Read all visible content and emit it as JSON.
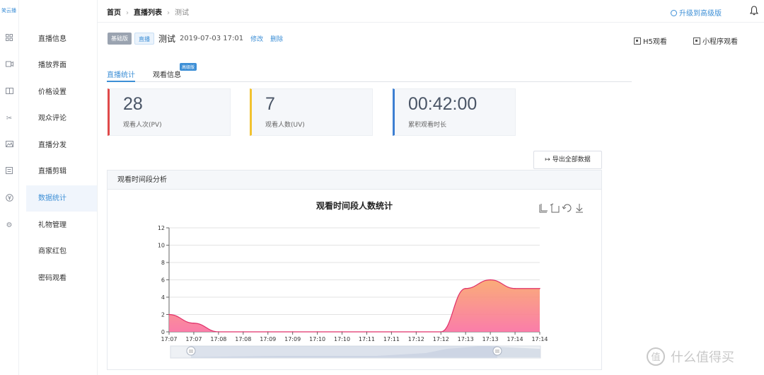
{
  "logo_text": "笑云播",
  "rail_icons": [
    "grid-icon",
    "video-icon",
    "book-icon",
    "scissors-icon",
    "image-icon",
    "list-icon",
    "yen-icon",
    "gear-icon"
  ],
  "sidebar": {
    "items": [
      {
        "label": "直播信息"
      },
      {
        "label": "播放界面"
      },
      {
        "label": "价格设置"
      },
      {
        "label": "观众评论"
      },
      {
        "label": "直播分发"
      },
      {
        "label": "直播剪辑"
      },
      {
        "label": "数据统计"
      },
      {
        "label": "礼物管理"
      },
      {
        "label": "商家红包"
      },
      {
        "label": "密码观看"
      }
    ],
    "active_index": 6
  },
  "breadcrumb": {
    "home": "首页",
    "list": "直播列表",
    "current": "测试"
  },
  "upgrade_label": "升级到高级版",
  "live": {
    "tag_plan": "基础版",
    "tag_type": "直播",
    "title": "测试",
    "time": "2019-07-03 17:01",
    "edit_label": "修改",
    "delete_label": "删除"
  },
  "watch_h5": "H5观看",
  "watch_mini": "小程序观看",
  "tabs": {
    "stats": "直播统计",
    "viewers": "观看信息",
    "viewers_badge": "高级版"
  },
  "stats": [
    {
      "value": "28",
      "label": "观看人次(PV)",
      "color": "#e04a4a"
    },
    {
      "value": "7",
      "label": "观看人数(UV)",
      "color": "#f2c230"
    },
    {
      "value": "00:42:00",
      "label": "累积观看时长",
      "color": "#3d7fd2"
    }
  ],
  "export_label": "导出全部数据",
  "panel_title": "观看时间段分析",
  "chart_data": {
    "type": "area",
    "title": "观看时间段人数统计",
    "x": [
      "17:07",
      "17:07",
      "17:08",
      "17:08",
      "17:09",
      "17:09",
      "17:10",
      "17:10",
      "17:11",
      "17:11",
      "17:12",
      "17:12",
      "17:13",
      "17:13",
      "17:14",
      "17:14"
    ],
    "values": [
      2,
      1,
      0,
      0,
      0,
      0,
      0,
      0,
      0,
      0,
      0,
      0,
      5,
      6,
      5,
      5
    ],
    "ylim": [
      0,
      12
    ],
    "yticks": [
      0,
      2,
      4,
      6,
      8,
      10,
      12
    ],
    "grid": true,
    "colors": {
      "line": "#e0306a",
      "fill_top": "#f9a36a",
      "fill_bottom": "#fa6fa0"
    }
  },
  "watermark": "值 什么值得买"
}
